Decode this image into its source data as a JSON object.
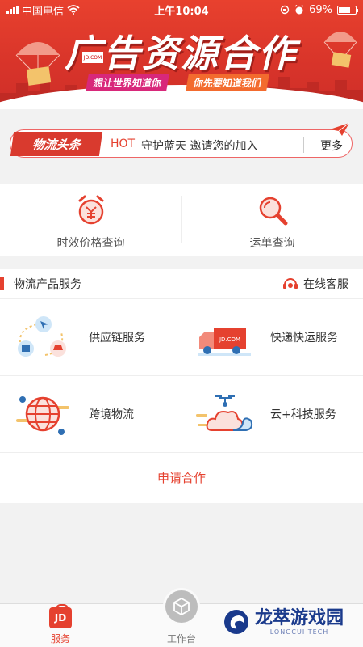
{
  "status_bar": {
    "carrier": "中国电信",
    "time": "上午10:04",
    "battery": "69%",
    "battery_level": 0.69
  },
  "banner": {
    "title": "广告资源合作",
    "subtitle_left": "想让世界知道你",
    "subtitle_right": "你先要知道我们",
    "box_label": "JD.COM"
  },
  "headline": {
    "logo_text": "物流头条",
    "hot": "HOT",
    "text": "守护蓝天 邀请您的加入",
    "more": "更多"
  },
  "tools": [
    {
      "label": "时效价格查询",
      "icon": "alarm-clock-yen-icon"
    },
    {
      "label": "运单查询",
      "icon": "magnifier-icon"
    }
  ],
  "services": {
    "title": "物流产品服务",
    "customer_service": "在线客服",
    "items": [
      {
        "label": "供应链服务",
        "icon": "supply-chain-icon"
      },
      {
        "label": "快递快运服务",
        "icon": "delivery-truck-icon",
        "truck_label": "JD.COM"
      },
      {
        "label": "跨境物流",
        "icon": "globe-icon"
      },
      {
        "label": "云+科技服务",
        "icon": "cloud-drone-icon"
      }
    ],
    "apply": "申请合作"
  },
  "bottom_nav": {
    "service_icon_text": "JD",
    "service": "服务",
    "workbench": "工作台"
  },
  "watermark": {
    "text": "龙萃游戏园",
    "sub": "LONGCUI TECH"
  },
  "colors": {
    "accent": "#e5412f",
    "banner": "#d8342a"
  }
}
